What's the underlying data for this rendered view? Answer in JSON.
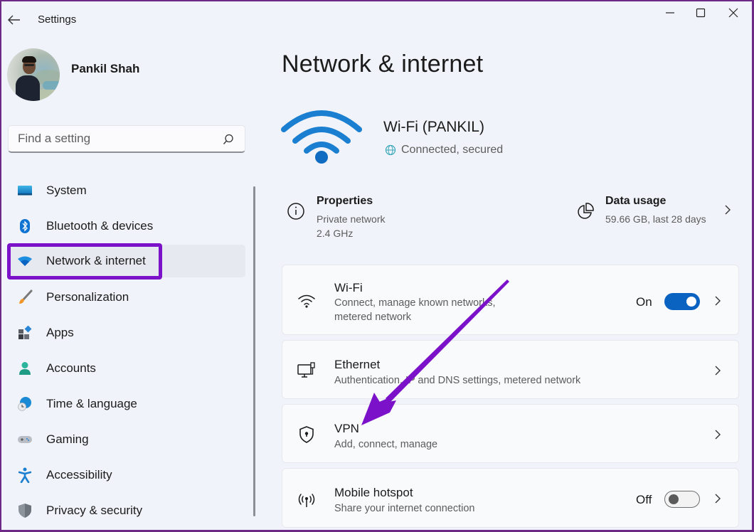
{
  "window": {
    "title": "Settings",
    "controls": {
      "minimize": "minimize",
      "maximize": "maximize",
      "close": "close"
    }
  },
  "profile": {
    "name": "Pankil Shah"
  },
  "search": {
    "placeholder": "Find a setting",
    "value": ""
  },
  "sidebar": {
    "items": [
      {
        "label": "System",
        "icon": "system-icon",
        "active": false
      },
      {
        "label": "Bluetooth & devices",
        "icon": "bluetooth-icon",
        "active": false
      },
      {
        "label": "Network & internet",
        "icon": "network-icon",
        "active": true
      },
      {
        "label": "Personalization",
        "icon": "brush-icon",
        "active": false
      },
      {
        "label": "Apps",
        "icon": "apps-icon",
        "active": false
      },
      {
        "label": "Accounts",
        "icon": "person-icon",
        "active": false
      },
      {
        "label": "Time & language",
        "icon": "globe-clock-icon",
        "active": false
      },
      {
        "label": "Gaming",
        "icon": "gamepad-icon",
        "active": false
      },
      {
        "label": "Accessibility",
        "icon": "accessibility-icon",
        "active": false
      },
      {
        "label": "Privacy & security",
        "icon": "shield-icon",
        "active": false
      }
    ]
  },
  "main": {
    "title": "Network & internet",
    "connection": {
      "name": "Wi-Fi (PANKIL)",
      "status": "Connected, secured"
    },
    "properties": {
      "title": "Properties",
      "line1": "Private network",
      "line2": "2.4 GHz"
    },
    "data_usage": {
      "title": "Data usage",
      "value": "59.66 GB, last 28 days"
    },
    "cards": [
      {
        "title": "Wi-Fi",
        "subtitle_line1": "Connect, manage known networks,",
        "subtitle_line2": "metered network",
        "toggle": {
          "state": "on",
          "label": "On"
        }
      },
      {
        "title": "Ethernet",
        "subtitle": "Authentication, IP and DNS settings, metered network"
      },
      {
        "title": "VPN",
        "subtitle": "Add, connect, manage"
      },
      {
        "title": "Mobile hotspot",
        "subtitle": "Share your internet connection",
        "toggle": {
          "state": "off",
          "label": "Off"
        }
      }
    ]
  },
  "annotation": {
    "highlight_color": "#7b12c9",
    "arrow_color": "#7b12c9",
    "arrow_target": "VPN",
    "highlighted_item": "Network & internet"
  },
  "colors": {
    "accent": "#0a63c0",
    "background": "#f0f3f9",
    "card": "#f9fafc",
    "wifi_blue": "#1a7fd0"
  }
}
